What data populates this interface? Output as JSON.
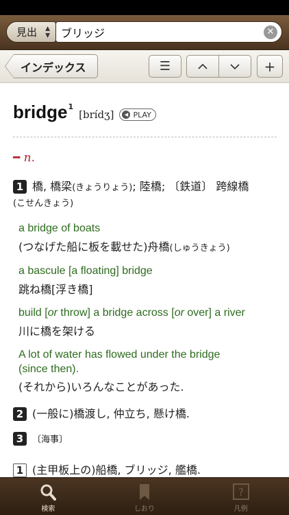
{
  "search": {
    "mode_label": "見出",
    "query": "ブリッジ"
  },
  "toolbar": {
    "back_label": "インデックス",
    "menu_glyph": "☰",
    "prev_glyph": "︿",
    "next_glyph": "﹀",
    "add_glyph": "+"
  },
  "entry": {
    "headword": "bridge",
    "superscript": "1",
    "pronunciation": "[brídʒ]",
    "play_label": "PLAY",
    "pos_mark": "━",
    "pos": "n.",
    "senses": [
      {
        "num": "1",
        "text": "橋, 橋梁",
        "reading": "(きょうりょう)",
        "text2": "; 陸橋; 〔鉄道〕 跨線橋",
        "reading2": "(こせんきょう)"
      },
      {
        "num": "2",
        "text": "(一般に)橋渡し, 仲立ち,  懸け橋."
      },
      {
        "num": "3",
        "text": "〔海事〕"
      }
    ],
    "examples": [
      {
        "en": "a bridge of boats",
        "ja": "(つなげた船に板を載せた)舟橋",
        "ja_reading": "(しゅうきょう)"
      },
      {
        "en": "a bascule [a floating] bridge",
        "ja": "跳ね橋[浮き橋]"
      },
      {
        "en_pre": "build [",
        "en_it1": "or",
        "en_mid": " throw] a bridge across [",
        "en_it2": "or",
        "en_post": " over] a river",
        "ja": "川に橋を架ける"
      },
      {
        "en": "A lot of water has flowed under the bridge",
        "en2": "(since then).",
        "ja": "(それから)いろんなことがあった."
      }
    ],
    "subsense": {
      "num": "1",
      "text": "(主甲板上の)船橋, ブリッジ,  艦橋."
    }
  },
  "tabbar": {
    "tabs": [
      {
        "label": "検索",
        "icon": "magnifier-icon",
        "active": true
      },
      {
        "label": "しおり",
        "icon": "bookmark-icon",
        "active": false
      },
      {
        "label": "凡例",
        "icon": "help-icon",
        "active": false
      }
    ]
  }
}
